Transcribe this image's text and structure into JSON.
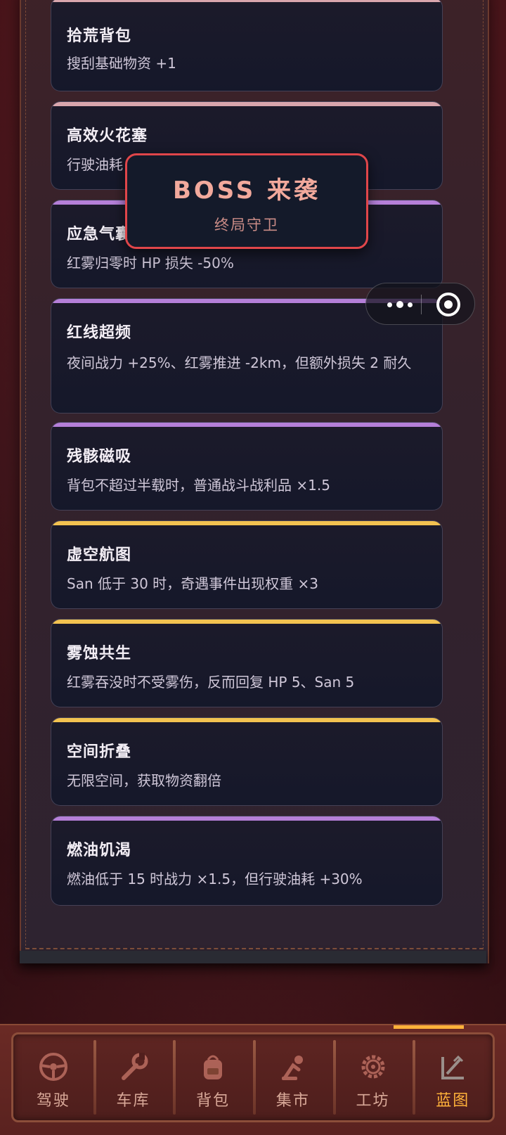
{
  "colors": {
    "bar_pink": "#d9a6ad",
    "bar_purple": "#b57fd8",
    "bar_gold": "#f3c250",
    "boss_border": "#e0464a",
    "active_tab": "#ffb23a"
  },
  "cards": [
    {
      "title": "拾荒背包",
      "desc": "搜刮基础物资 +1",
      "rarity": "common"
    },
    {
      "title": "高效火花塞",
      "desc": "行驶油耗 -5%",
      "rarity": "common"
    },
    {
      "title": "应急气囊",
      "desc": "红雾归零时 HP 损失 -50%",
      "rarity": "epic"
    },
    {
      "title": "红线超频",
      "desc": "夜间战力 +25%、红雾推进 -2km，但额外损失 2 耐久",
      "rarity": "epic"
    },
    {
      "title": "残骸磁吸",
      "desc": "背包不超过半载时，普通战斗战利品 ×1.5",
      "rarity": "epic"
    },
    {
      "title": "虚空航图",
      "desc": "San 低于 30 时，奇遇事件出现权重 ×3",
      "rarity": "legendary"
    },
    {
      "title": "雾蚀共生",
      "desc": "红雾吞没时不受雾伤，反而回复 HP 5、San 5",
      "rarity": "legendary"
    },
    {
      "title": "空间折叠",
      "desc": "无限空间，获取物资翻倍",
      "rarity": "legendary"
    },
    {
      "title": "燃油饥渴",
      "desc": "燃油低于 15 时战力 ×1.5，但行驶油耗 +30%",
      "rarity": "epic"
    }
  ],
  "boss": {
    "title": "BOSS 来袭",
    "subtitle": "终局守卫"
  },
  "capsule": {
    "more_icon": "more-dots-icon",
    "close_icon": "target-close-icon"
  },
  "tabs": [
    {
      "label": "驾驶",
      "icon": "steering-wheel-icon"
    },
    {
      "label": "车库",
      "icon": "wrench-icon"
    },
    {
      "label": "背包",
      "icon": "backpack-icon"
    },
    {
      "label": "集市",
      "icon": "market-icon"
    },
    {
      "label": "工坊",
      "icon": "gear-icon"
    },
    {
      "label": "蓝图",
      "icon": "blueprint-icon"
    }
  ],
  "active_tab": "蓝图"
}
